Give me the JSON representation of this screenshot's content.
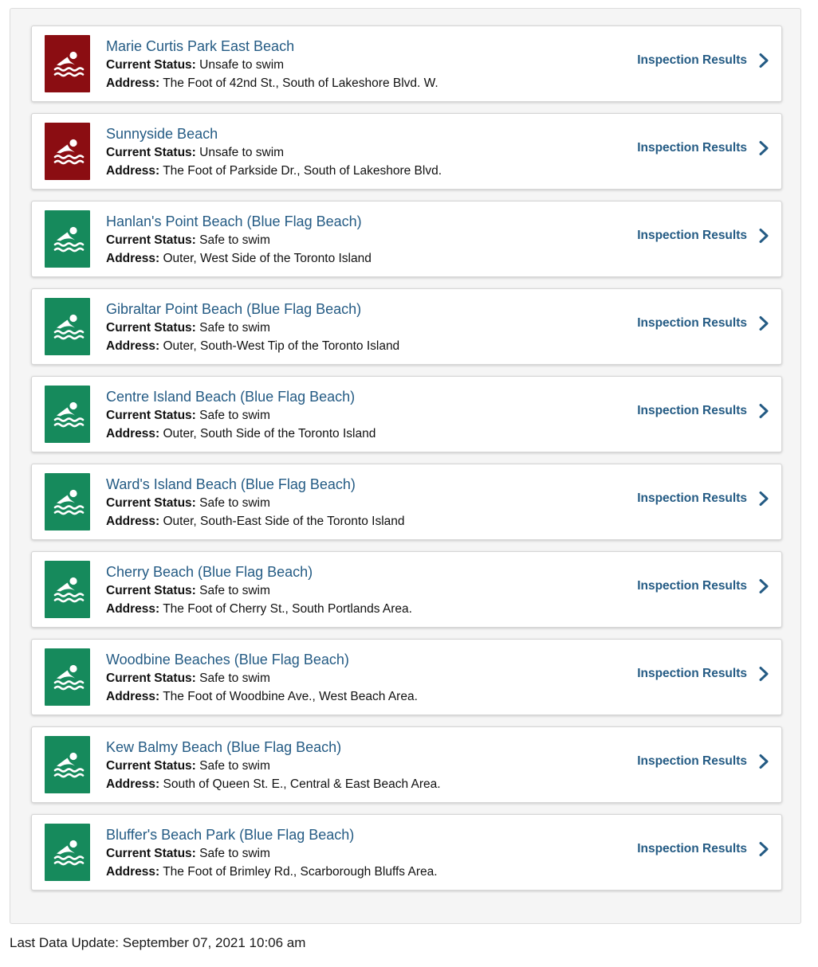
{
  "colors": {
    "unsafe": "#8b0d12",
    "safe": "#168a5c",
    "link": "#245b84"
  },
  "labels": {
    "status": "Current Status:",
    "address": "Address:",
    "inspection": "Inspection Results"
  },
  "icons": {
    "beach": "swimmer-icon",
    "arrow": "chevron-right-icon"
  },
  "beaches": [
    {
      "name": "Marie Curtis Park East Beach",
      "status": "Unsafe to swim",
      "safe": false,
      "address": "The Foot of 42nd St., South of Lakeshore Blvd. W."
    },
    {
      "name": "Sunnyside Beach",
      "status": "Unsafe to swim",
      "safe": false,
      "address": "The Foot of Parkside Dr., South of Lakeshore Blvd."
    },
    {
      "name": "Hanlan's Point Beach (Blue Flag Beach)",
      "status": "Safe to swim",
      "safe": true,
      "address": "Outer, West Side of the Toronto Island"
    },
    {
      "name": "Gibraltar Point Beach (Blue Flag Beach)",
      "status": "Safe to swim",
      "safe": true,
      "address": "Outer, South-West Tip of the Toronto Island"
    },
    {
      "name": "Centre Island Beach (Blue Flag Beach)",
      "status": "Safe to swim",
      "safe": true,
      "address": "Outer, South Side of the Toronto Island"
    },
    {
      "name": "Ward's Island Beach (Blue Flag Beach)",
      "status": "Safe to swim",
      "safe": true,
      "address": "Outer, South-East Side of the Toronto Island"
    },
    {
      "name": "Cherry Beach (Blue Flag Beach)",
      "status": "Safe to swim",
      "safe": true,
      "address": "The Foot of Cherry St., South Portlands Area."
    },
    {
      "name": "Woodbine Beaches (Blue Flag Beach)",
      "status": "Safe to swim",
      "safe": true,
      "address": "The Foot of Woodbine Ave., West Beach Area."
    },
    {
      "name": "Kew Balmy Beach (Blue Flag Beach)",
      "status": "Safe to swim",
      "safe": true,
      "address": "South of Queen St. E., Central & East Beach Area."
    },
    {
      "name": "Bluffer's Beach Park (Blue Flag Beach)",
      "status": "Safe to swim",
      "safe": true,
      "address": "The Foot of Brimley Rd., Scarborough Bluffs Area."
    }
  ],
  "footer": {
    "text": "Last Data Update: September 07, 2021 10:06 am"
  }
}
